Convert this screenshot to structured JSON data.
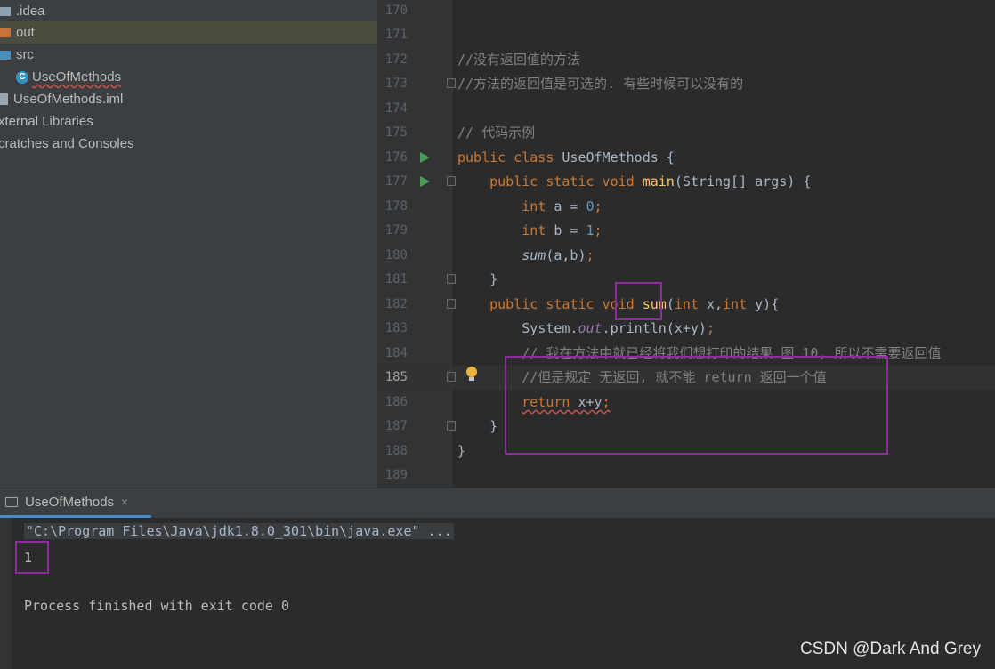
{
  "project_tree": {
    "items": [
      {
        "label": ".idea",
        "icon": "folder-icon",
        "color": "#8fa2b2"
      },
      {
        "label": "out",
        "icon": "folder-icon",
        "color": "#c8733a",
        "selected": true
      },
      {
        "label": "src",
        "icon": "folder-icon",
        "color": "#4b8fbd"
      },
      {
        "label": "UseOfMethods",
        "icon": "java-class-icon"
      },
      {
        "label": "UseOfMethods.iml",
        "icon": "file-icon"
      },
      {
        "label": "xternal Libraries"
      },
      {
        "label": "cratches and Consoles"
      }
    ]
  },
  "editor": {
    "line_numbers": [
      "170",
      "171",
      "172",
      "173",
      "174",
      "175",
      "176",
      "177",
      "178",
      "179",
      "180",
      "181",
      "182",
      "183",
      "184",
      "185",
      "186",
      "187",
      "188",
      "189"
    ],
    "current_line": "185",
    "lines": {
      "l172": "//没有返回值的方法",
      "l173": "//方法的返回值是可选的. 有些时候可以没有的",
      "l175": "// 代码示例",
      "l176": {
        "kw": "public class ",
        "name": " UseOfMethods {"
      },
      "l176_name": "UseOfMethods",
      "l177": {
        "kw": "public static void ",
        "fn": "main",
        "rest": "(String[] args) {"
      },
      "l178": {
        "kw": "int ",
        "rest": "a = ",
        "num": "0",
        "end": ";"
      },
      "l179": {
        "kw": "int ",
        "rest": "b = ",
        "num": "1",
        "end": ";"
      },
      "l180": {
        "fn": "sum",
        "rest": "(a,b)",
        "end": ";"
      },
      "l181": "}",
      "l182": {
        "kw1": "public static ",
        "void": "void",
        "fn": "sum",
        "p1": "(",
        "kw2": "int",
        "p2": " x,",
        "kw3": "int",
        "p3": " y){"
      },
      "l183": {
        "a": "System.",
        "out": "out",
        "b": ".println(x+y)",
        "end": ";"
      },
      "l184": "// 我在方法中就已经将我们想打印的结果 图 10, 所以不需要返回值",
      "l185": "//但是规定 无返回, 就不能 return 返回一个值",
      "l186": {
        "kw": "return",
        "rest": " x+y",
        "end": ";"
      },
      "l187": "}",
      "l188": "}"
    }
  },
  "run_panel": {
    "tab_label": "UseOfMethods",
    "close_glyph": "×",
    "command": "\"C:\\Program Files\\Java\\jdk1.8.0_301\\bin\\java.exe\" ...",
    "output": "1",
    "exit_message": "Process finished with exit code 0"
  },
  "watermark": "CSDN @Dark And Grey",
  "colors": {
    "keyword": "#cc7832",
    "function": "#ffc66d",
    "number": "#6897bb",
    "static_field": "#9876aa",
    "comment": "#808080",
    "highlight_box": "#8e2da0"
  }
}
